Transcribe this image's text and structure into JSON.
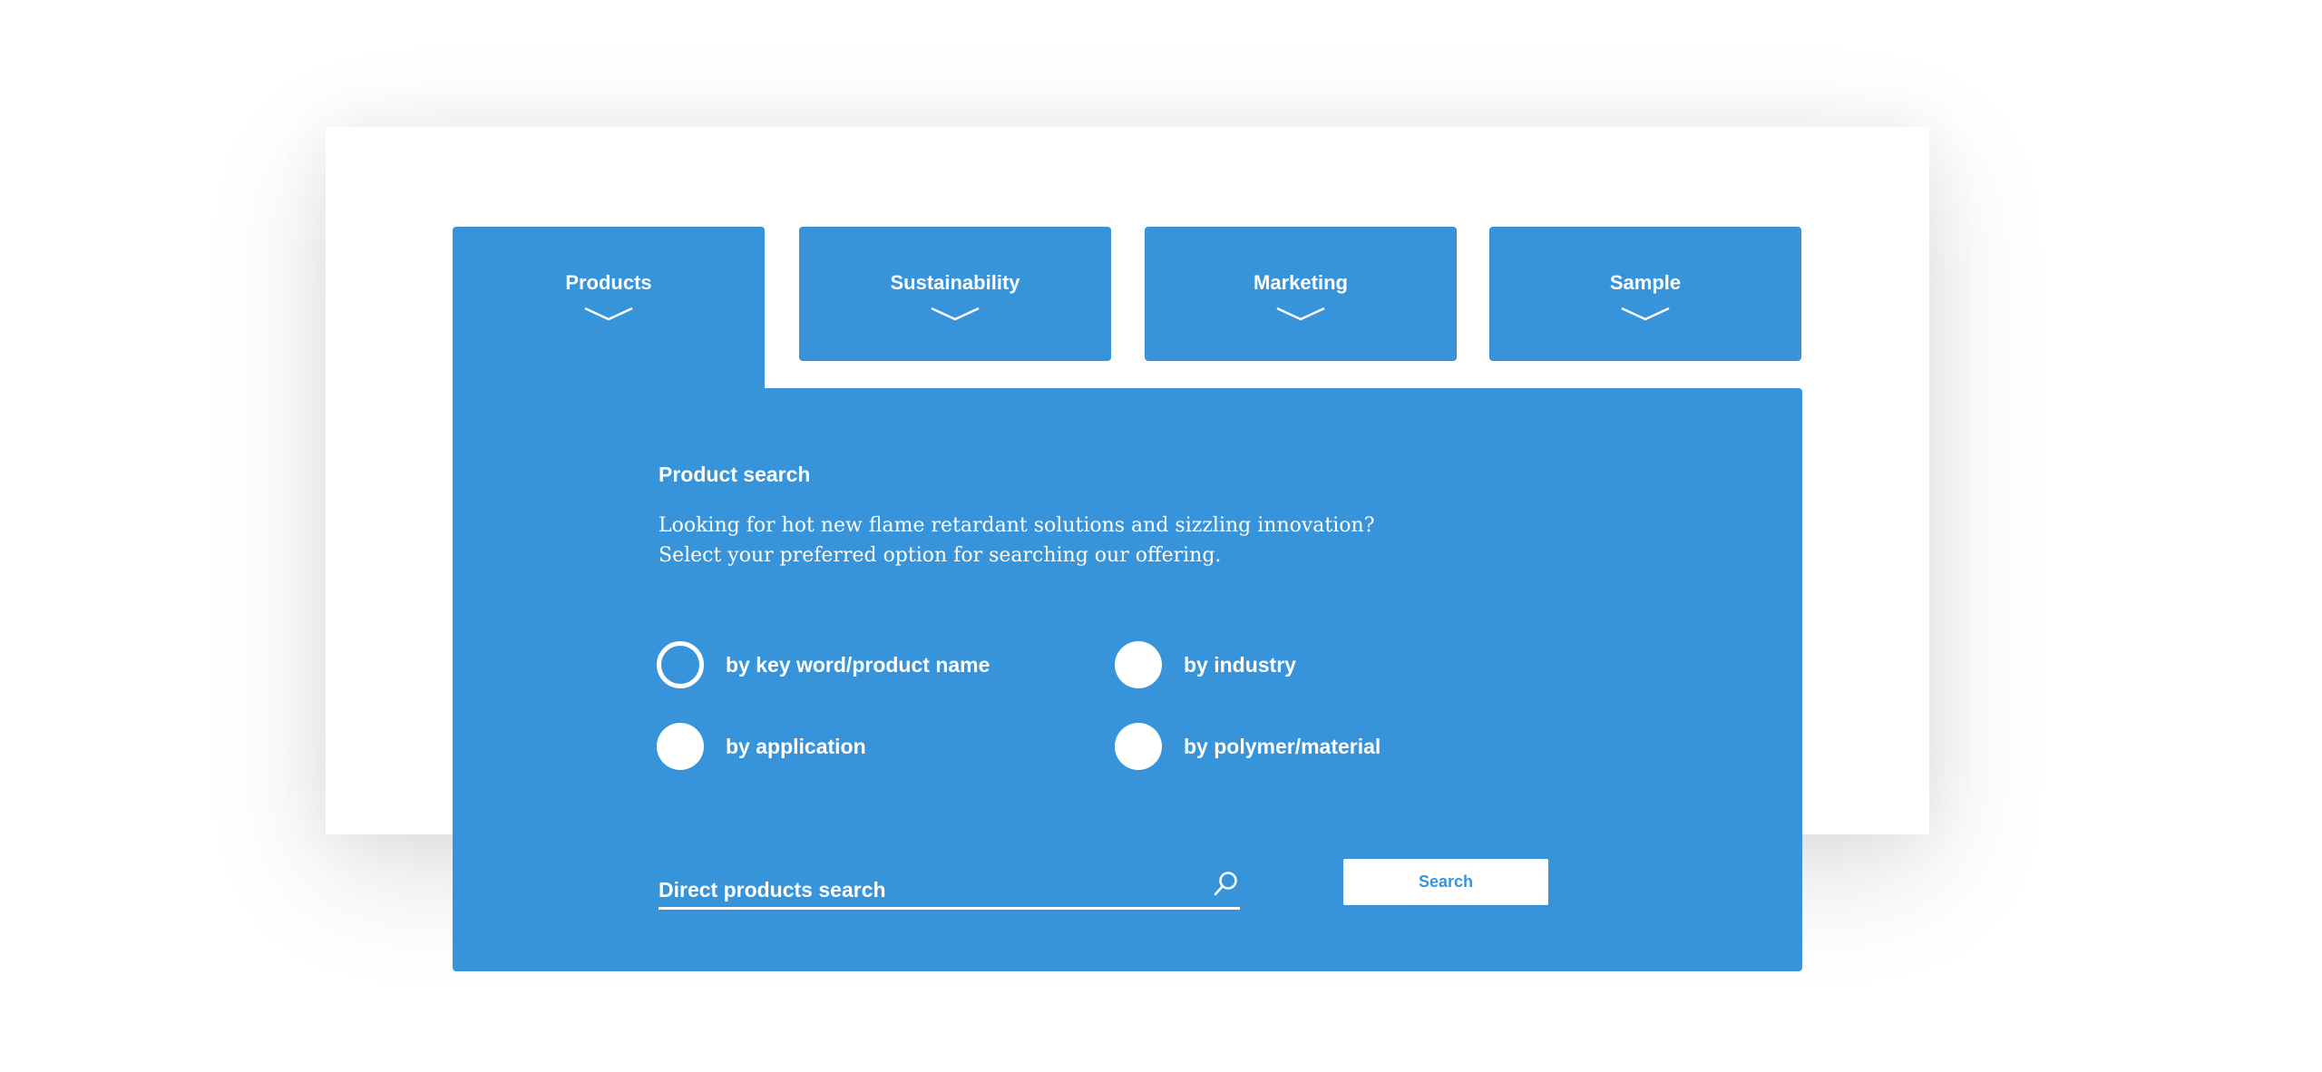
{
  "tabs": [
    {
      "label": "Products",
      "active": true
    },
    {
      "label": "Sustainability",
      "active": false
    },
    {
      "label": "Marketing",
      "active": false
    },
    {
      "label": "Sample",
      "active": false
    }
  ],
  "panel": {
    "title": "Product search",
    "description_lines": [
      "Looking for hot new flame retardant solutions and sizzling innovation?",
      "Select your preferred option for searching our offering."
    ],
    "options": [
      {
        "label": "by key word/product name",
        "selected": true
      },
      {
        "label": "by industry",
        "selected": false
      },
      {
        "label": "by application",
        "selected": false
      },
      {
        "label": "by polymer/material",
        "selected": false
      }
    ],
    "search": {
      "placeholder": "Direct products search",
      "icon": "search-icon",
      "button_label": "Search"
    }
  },
  "colors": {
    "accent": "#3794da",
    "background": "#ffffff",
    "text_on_accent": "#ffffff"
  }
}
